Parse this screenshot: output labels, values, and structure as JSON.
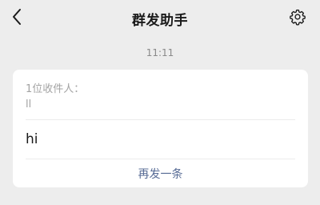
{
  "header": {
    "title": "群发助手",
    "back_icon": "chevron-left-icon",
    "settings_icon": "gear-icon"
  },
  "timestamp": "11:11",
  "message_card": {
    "recipient_label": "1位收件人：",
    "recipient_names": "ll",
    "message": "hi",
    "resend_label": "再发一条"
  },
  "colors": {
    "background": "#ededed",
    "card": "#ffffff",
    "link": "#576b95",
    "muted_text": "#a3a3a3"
  }
}
